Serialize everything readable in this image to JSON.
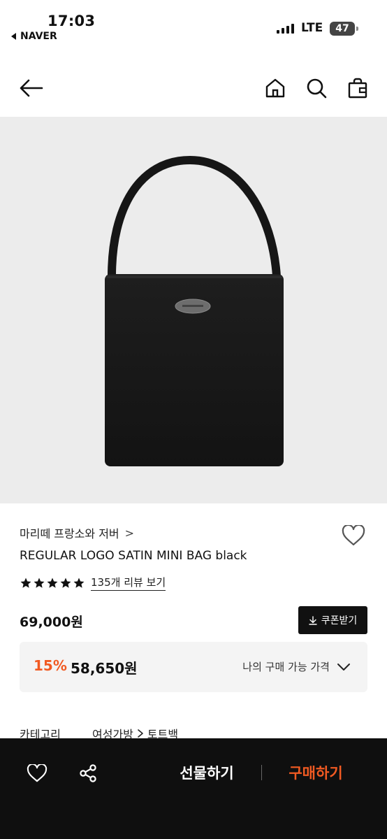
{
  "status_bar": {
    "time": "17:03",
    "back_app": "NAVER",
    "network": "LTE",
    "battery": "47"
  },
  "nav": {
    "back_icon": "arrow-left-icon",
    "home_icon": "home-icon",
    "search_icon": "search-icon",
    "cart_icon": "shopping-bag-icon"
  },
  "product": {
    "brand": "마리떼 프랑소와 저버",
    "brand_chevron": ">",
    "name": "REGULAR LOGO SATIN MINI BAG black",
    "rating_stars": 5,
    "review_link": "135개 리뷰 보기",
    "price": "69,000원",
    "coupon_button": "쿠폰받기",
    "discount_rate": "15%",
    "sale_price": "58,650원",
    "my_price_label": "나의 구매 가능 가격",
    "category_label": "카테고리",
    "category_path": [
      "여성가방",
      "토트백"
    ]
  },
  "bottom_bar": {
    "gift_button": "선물하기",
    "buy_button": "구매하기"
  },
  "colors": {
    "accent": "#f15a22",
    "bottom_bar_bg": "#0f0f0f",
    "image_bg": "#ececec"
  }
}
